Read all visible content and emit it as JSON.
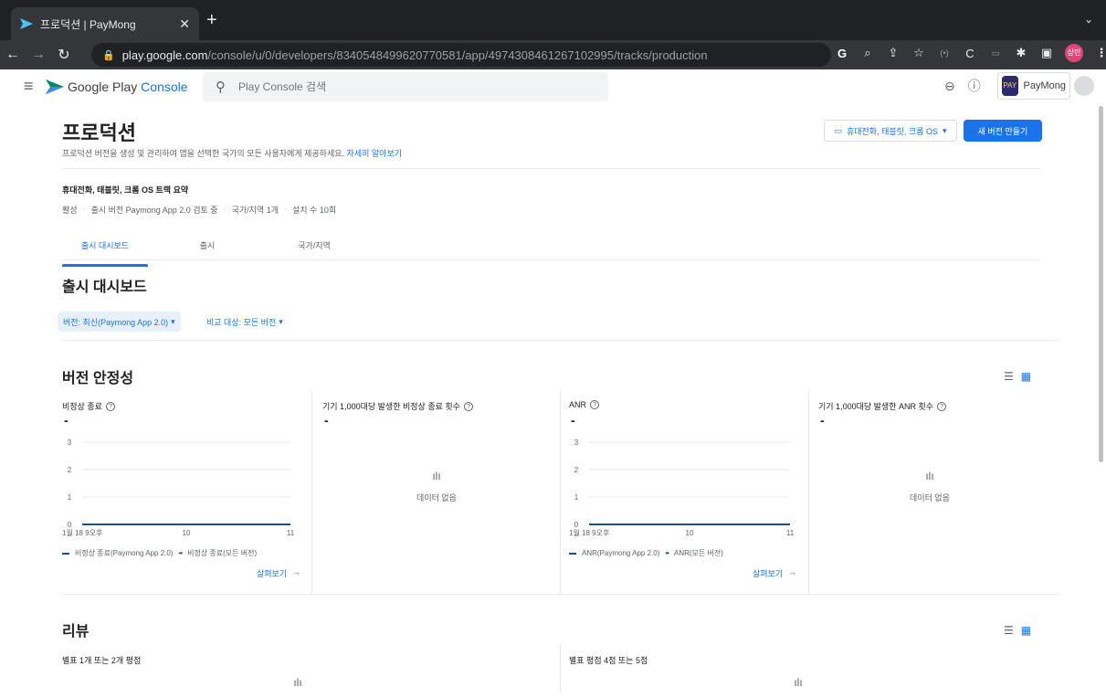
{
  "browser": {
    "tab_title": "프로덕션 | PayMong",
    "url_host": "play.google.com",
    "url_path": "/console/u/0/developers/8340548499620770581/app/4974308461267102995/tracks/production",
    "profile_label": "상민"
  },
  "header": {
    "logo_main": "Google Play",
    "logo_sub": "Console",
    "search_placeholder": "Play Console 검색",
    "account_name": "PayMong",
    "app_icon_text": "PAY"
  },
  "page": {
    "title": "프로덕션",
    "description": "프로덕션 버전을 생성 및 관리하여 앱을 선택한 국가의 모든 사용자에게 제공하세요.",
    "learn_more": "자세히 알아보기",
    "device_select": "휴대전화, 태블릿, 크롬 OS",
    "new_release_button": "새 버전 만들기"
  },
  "summary": {
    "title": "휴대전화, 태블릿, 크롬 OS 트랙 요약",
    "items": [
      "활성",
      "출시 버전 Paymong App 2.0 검토 중",
      "국가/지역 1개",
      "설치 수 10회"
    ]
  },
  "tabs": [
    "출시 대시보드",
    "출시",
    "국가/지역"
  ],
  "dashboard": {
    "title": "출시 대시보드",
    "filter_version": "버전: 최신(Paymong App 2.0)",
    "filter_compare": "비교 대상: 모든 버전"
  },
  "stability": {
    "title": "버전 안정성",
    "cards": [
      {
        "label": "비정상 종료",
        "value": "-"
      },
      {
        "label": "기기 1,000대당 발생한 비정상 종료 횟수",
        "value": "-",
        "no_data": "데이터 없음"
      },
      {
        "label": "ANR",
        "value": "-"
      },
      {
        "label": "기기 1,000대당 발생한 ANR 횟수",
        "value": "-",
        "no_data": "데이터 없음"
      }
    ],
    "legend_crash": [
      "비정상 종료(Paymong App 2.0)",
      "비정상 종료(모든 버전)"
    ],
    "legend_anr": [
      "ANR(Paymong App 2.0)",
      "ANR(모든 버전)"
    ],
    "more_link": "살펴보기",
    "more_arrow": "→"
  },
  "reviews": {
    "title": "리뷰",
    "low_label": "별표 1개 또는 2개 평점",
    "high_label": "별표 평점 4점 또는 5점"
  },
  "chart_data": [
    {
      "type": "line",
      "name": "crash",
      "yticks": [
        "0",
        "1",
        "2",
        "3"
      ],
      "xticks": [
        "1월 18 9오후",
        "10",
        "11"
      ],
      "ylim": [
        0,
        3
      ],
      "series": [
        {
          "name": "비정상 종료(Paymong App 2.0)",
          "values": [
            0,
            0,
            0
          ]
        }
      ],
      "grid": true,
      "legend_placement": "bottom"
    },
    {
      "type": "line",
      "name": "anr",
      "yticks": [
        "0",
        "1",
        "2",
        "3"
      ],
      "xticks": [
        "1월 18 9오후",
        "10",
        "11"
      ],
      "ylim": [
        0,
        3
      ],
      "series": [
        {
          "name": "ANR(Paymong App 2.0)",
          "values": [
            0,
            0,
            0
          ]
        }
      ],
      "grid": true,
      "legend_placement": "bottom"
    }
  ]
}
